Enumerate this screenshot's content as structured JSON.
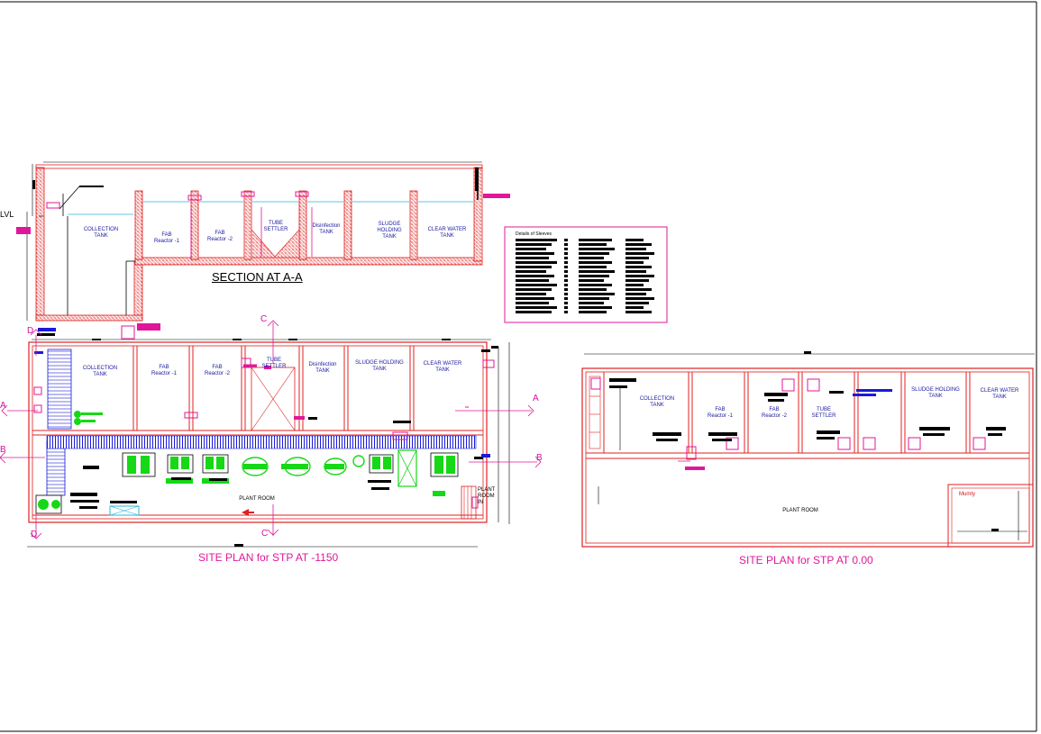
{
  "colors": {
    "wall": "#e02020",
    "hatch": "#e02020",
    "water": "#2ab8d8",
    "dimension": "#000000",
    "label": "#1a1aa0",
    "magenta": "#e0179a",
    "green": "#16d816",
    "blue": "#1a1ad8",
    "black_block": "#000000"
  },
  "section": {
    "title": "SECTION AT A-A",
    "level_label": "LVL",
    "tanks": [
      {
        "line1": "COLLECTION",
        "line2": "TANK"
      },
      {
        "line1": "FAB",
        "line2": "Reactor -1"
      },
      {
        "line1": "FAB",
        "line2": "Reactor -2"
      },
      {
        "line1": "TUBE",
        "line2": "SETTLER"
      },
      {
        "line1": "Disinfection",
        "line2": "TANK"
      },
      {
        "line1": "SLUDGE",
        "line2": "HOLDING",
        "line3": "TANK"
      },
      {
        "line1": "CLEAR WATER",
        "line2": "TANK"
      }
    ]
  },
  "sleeves": {
    "heading": "Details of Sleeves"
  },
  "plan1": {
    "title": "SITE PLAN for STP  AT -1150",
    "tanks": [
      {
        "line1": "COLLECTION",
        "line2": "TANK"
      },
      {
        "line1": "FAB",
        "line2": "Reactor -1"
      },
      {
        "line1": "FAB",
        "line2": "Reactor -2"
      },
      {
        "line1": "TUBE",
        "line2": "SETTLER"
      },
      {
        "line1": "Disinfection",
        "line2": "TANK"
      },
      {
        "line1": "SLUDGE HOLDING",
        "line2": "TANK"
      },
      {
        "line1": "CLEAR WATER",
        "line2": "TANK"
      }
    ],
    "plant_room": "PLANT ROOM",
    "plant_room_in": {
      "line1": "PLANT",
      "line2": "ROOM",
      "line3": "IN"
    },
    "section_marks": [
      "A",
      "A",
      "B",
      "B",
      "C",
      "C",
      "D",
      "D"
    ]
  },
  "plan2": {
    "title": "SITE PLAN for STP AT 0.00",
    "tanks": [
      {
        "line1": "COLLECTION",
        "line2": "TANK"
      },
      {
        "line1": "FAB",
        "line2": "Reactor -1"
      },
      {
        "line1": "FAB",
        "line2": "Reactor -2"
      },
      {
        "line1": "TUBE",
        "line2": "SETTLER"
      },
      {
        "line1": "SLUDGE HOLDING",
        "line2": "TANK"
      },
      {
        "line1": "CLEAR WATER",
        "line2": "TANK"
      }
    ],
    "plant_room": "PLANT ROOM",
    "mumty": "Mumty"
  }
}
